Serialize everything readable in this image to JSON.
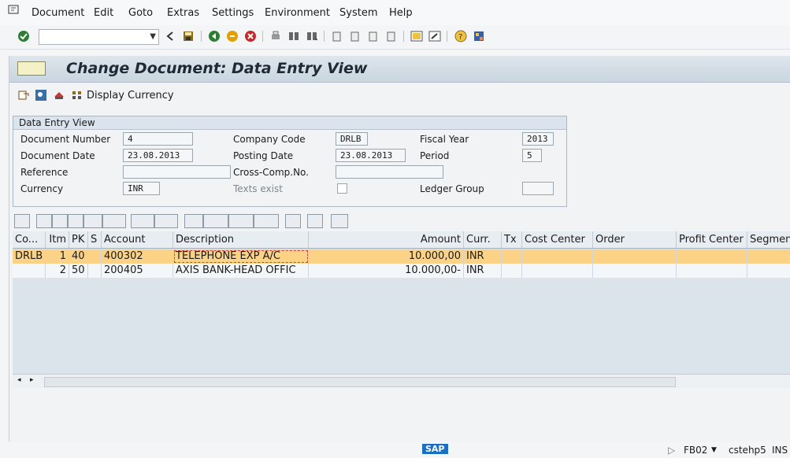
{
  "menu": {
    "items": [
      {
        "label": "Document"
      },
      {
        "label": "Edit"
      },
      {
        "label": "Goto"
      },
      {
        "label": "Extras"
      },
      {
        "label": "Settings"
      },
      {
        "label": "Environment"
      },
      {
        "label": "System"
      },
      {
        "label": "Help"
      }
    ]
  },
  "toolbar": {
    "command_field": ""
  },
  "screen": {
    "title": "Change Document: Data Entry View",
    "display_currency_label": "Display Currency"
  },
  "header_group": {
    "title": "Data Entry View",
    "document_number_label": "Document Number",
    "document_number": "4",
    "company_code_label": "Company Code",
    "company_code": "DRLB",
    "fiscal_year_label": "Fiscal Year",
    "fiscal_year": "2013",
    "document_date_label": "Document Date",
    "document_date": "23.08.2013",
    "posting_date_label": "Posting Date",
    "posting_date": "23.08.2013",
    "period_label": "Period",
    "period": "5",
    "reference_label": "Reference",
    "reference": "",
    "cross_comp_label": "Cross-Comp.No.",
    "cross_comp": "",
    "currency_label": "Currency",
    "currency": "INR",
    "texts_exist_label": "Texts exist",
    "ledger_group_label": "Ledger Group",
    "ledger_group": ""
  },
  "grid": {
    "columns": [
      "Co...",
      "Itm",
      "PK",
      "S",
      "Account",
      "Description",
      "Amount",
      "Curr.",
      "Tx",
      "Cost Center",
      "Order",
      "Profit Center",
      "Segment"
    ],
    "rows": [
      {
        "co": "DRLB",
        "itm": "1",
        "pk": "40",
        "s": "",
        "account": "400302",
        "description": "TELEPHONE EXP A/C",
        "amount": "10.000,00",
        "curr": "INR"
      },
      {
        "co": "",
        "itm": "2",
        "pk": "50",
        "s": "",
        "account": "200405",
        "description": "AXIS BANK-HEAD OFFIC",
        "amount": "10.000,00-",
        "curr": "INR"
      }
    ]
  },
  "status": {
    "brand": "SAP",
    "transaction": "FB02",
    "server": "cstehp5",
    "mode": "INS"
  },
  "colors": {
    "selected_row": "#fbd286",
    "title_bar": "#c9d5df"
  }
}
